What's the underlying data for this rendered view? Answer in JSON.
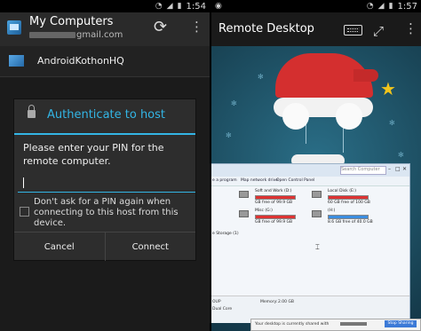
{
  "left": {
    "status": {
      "time": "1:54"
    },
    "actionbar": {
      "title": "My Computers",
      "account": "gmail.com"
    },
    "host": {
      "label": "AndroidKothonHQ"
    },
    "dialog": {
      "title": "Authenticate to host",
      "message": "Please enter your PIN for the remote computer.",
      "pin_value": "",
      "checkbox_label": "Don't ask for a PIN again when connecting to this host from this device.",
      "cancel_label": "Cancel",
      "connect_label": "Connect"
    }
  },
  "right": {
    "status": {
      "time": "1:57"
    },
    "actionbar": {
      "title": "Remote Desktop"
    },
    "window": {
      "search_placeholder": "Search Computer",
      "links": [
        "e a program",
        "Map network drive",
        "Open Control Panel"
      ],
      "section": "e Storage (1)",
      "drives": [
        {
          "name": "Soft and Work (D:)",
          "free": "GB free of 99.9 GB"
        },
        {
          "name": "Local Disk (E:)",
          "free": "60 GB free of 100 GB"
        },
        {
          "name": "Misc (G:)",
          "free": "GB free of 99.9 GB"
        },
        {
          "name": "(H:)",
          "free": "8.6 GB free of 40.0 GB"
        }
      ],
      "footer": {
        "left1": "OUP",
        "left2": "Dual Core",
        "memory_label": "Memory:",
        "memory_value": "2.00 GB"
      }
    },
    "share": {
      "text": "Your desktop is currently shared with",
      "button": "Stop Sharing"
    }
  }
}
